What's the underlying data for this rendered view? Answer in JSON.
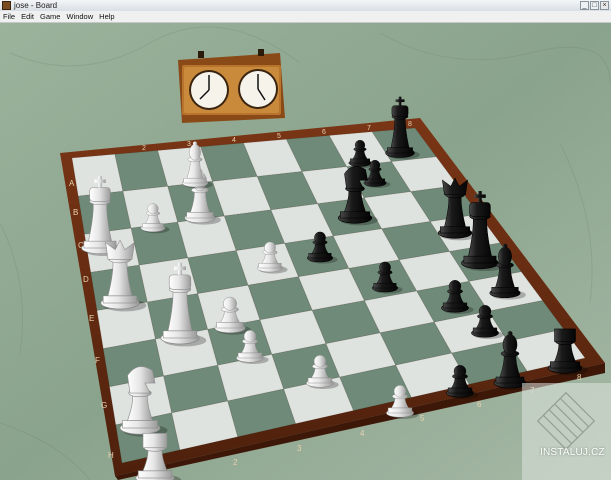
{
  "window": {
    "title": "jose - Board"
  },
  "menu": {
    "items": [
      "File",
      "Edit",
      "Game",
      "Window",
      "Help"
    ]
  },
  "board": {
    "rank_labels": [
      "A",
      "B",
      "C",
      "D",
      "E",
      "F",
      "G",
      "H"
    ],
    "file_labels_far": [
      "2",
      "3",
      "4",
      "5",
      "6",
      "7",
      "8"
    ],
    "file_labels_near": [
      "2",
      "3",
      "4",
      "5",
      "6",
      "7",
      "8"
    ]
  },
  "watermark": {
    "text": "INSTALUJ.CZ"
  },
  "colors": {
    "frame": "#6b2e12",
    "light_square": "#dfe3e0",
    "dark_square": "#6f8a78",
    "clock_case": "#9a5a1e"
  }
}
